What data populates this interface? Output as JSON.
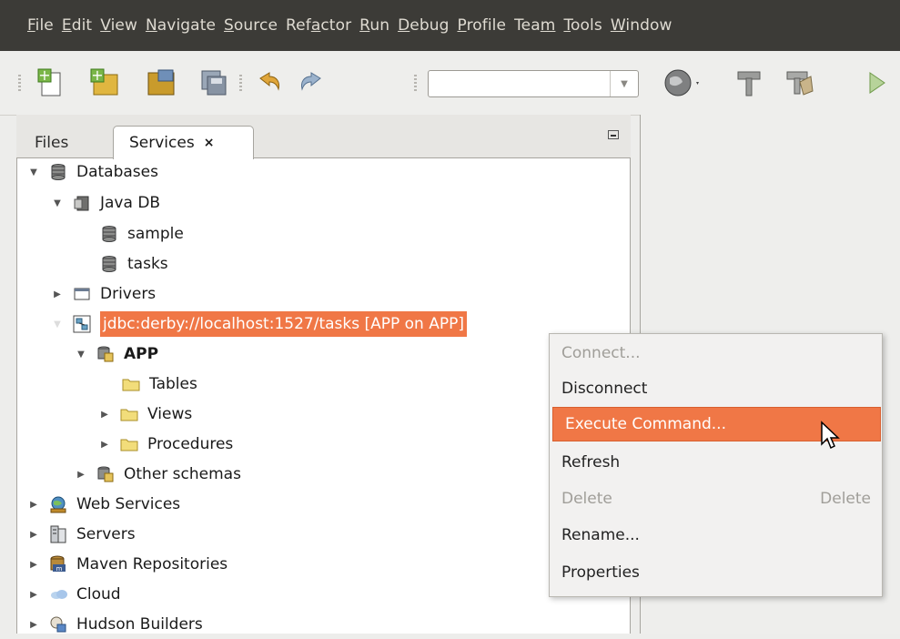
{
  "menubar": {
    "items": [
      {
        "label": "File",
        "u": "F",
        "rest": "ile"
      },
      {
        "label": "Edit",
        "u": "E",
        "rest": "dit"
      },
      {
        "label": "View",
        "u": "V",
        "rest": "iew"
      },
      {
        "label": "Navigate",
        "u": "N",
        "rest": "avigate"
      },
      {
        "label": "Source",
        "u": "S",
        "rest": "ource"
      },
      {
        "label": "Refactor",
        "pre": "Ref",
        "u": "a",
        "rest": "ctor"
      },
      {
        "label": "Run",
        "u": "R",
        "rest": "un"
      },
      {
        "label": "Debug",
        "u": "D",
        "rest": "ebug"
      },
      {
        "label": "Profile",
        "u": "P",
        "rest": "rofile"
      },
      {
        "label": "Team",
        "pre": "Tea",
        "u": "m",
        "rest": ""
      },
      {
        "label": "Tools",
        "u": "T",
        "rest": "ools"
      },
      {
        "label": "Window",
        "u": "W",
        "rest": "indow"
      }
    ]
  },
  "toolbar": {
    "icons": [
      "new-file-icon",
      "new-project-icon",
      "open-project-icon",
      "save-all-icon",
      "undo-icon",
      "redo-icon",
      "globe-icon",
      "build-icon",
      "clean-build-icon",
      "run-icon"
    ],
    "combo_value": ""
  },
  "tabs": {
    "files": "Files",
    "services": "Services",
    "close": "×"
  },
  "tree": {
    "databases": "Databases",
    "java_db": "Java DB",
    "sample": "sample",
    "tasks": "tasks",
    "drivers": "Drivers",
    "connection": "jdbc:derby://localhost:1527/tasks [APP on APP]",
    "app": "APP",
    "tables": "Tables",
    "views": "Views",
    "procedures": "Procedures",
    "other_schemas": "Other schemas",
    "web_services": "Web Services",
    "servers": "Servers",
    "maven": "Maven Repositories",
    "cloud": "Cloud",
    "hudson": "Hudson Builders"
  },
  "context_menu": {
    "connect": "Connect...",
    "disconnect": "Disconnect",
    "execute": "Execute Command...",
    "refresh": "Refresh",
    "delete": "Delete",
    "delete_accel": "Delete",
    "rename": "Rename...",
    "properties": "Properties"
  },
  "colors": {
    "selection": "#f07746",
    "menubar_bg": "#3c3b37",
    "menubar_text": "#dfdbd2"
  }
}
